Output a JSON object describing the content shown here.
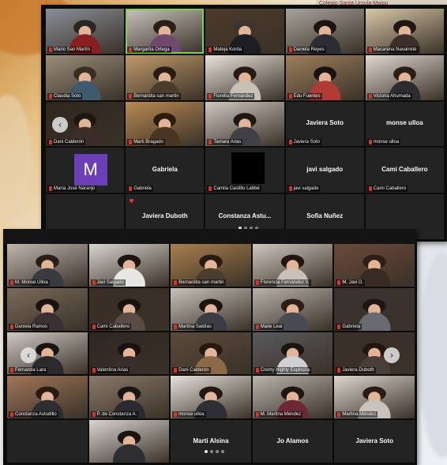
{
  "banner": "Colegio Santa Ursula-Maipu",
  "screen1": {
    "tiles": [
      {
        "name": "Mario San Martín",
        "kind": "video",
        "c1": "#8a8f99",
        "c2": "#2b2622",
        "c3": "#8a1f22"
      },
      {
        "name": "Margarita Ortega",
        "kind": "video",
        "active": true,
        "c1": "#c7c4bd",
        "c2": "#2a1e18",
        "c3": "#6f4a6e"
      },
      {
        "name": "Mateja Korda",
        "kind": "video",
        "c1": "#4d3a2b",
        "c2": "#3d3431",
        "c3": "#1d1d22"
      },
      {
        "name": "Daniela Reyes",
        "kind": "video",
        "c1": "#a8a39b",
        "c2": "#1a1512",
        "c3": "#2c2c33"
      },
      {
        "name": "Macarena Navarrete",
        "kind": "video",
        "c1": "#d7c7a7",
        "c2": "#201613",
        "c3": "#3a2f2a"
      },
      {
        "name": "Claudia Soto",
        "kind": "video",
        "c1": "#9a8e7a",
        "c2": "#3a2f27",
        "c3": "#3e5a6c"
      },
      {
        "name": "Bernardita san martin",
        "kind": "video",
        "c1": "#c09a6a",
        "c2": "#2a1c14",
        "c3": "#4a3d2e"
      },
      {
        "name": "Fiorella Fernández",
        "kind": "video",
        "c1": "#e8e2d8",
        "c2": "#2a1a14",
        "c3": "#c8c0b5"
      },
      {
        "name": "Edu Fuentes",
        "kind": "video",
        "c1": "#9c7e5c",
        "c2": "#1a1210",
        "c3": "#b03a34"
      },
      {
        "name": "Victoria Ahumada",
        "kind": "video",
        "c1": "#e0d8cf",
        "c2": "#2a1e16",
        "c3": "#2b2b30"
      },
      {
        "name": "Dani Calderón",
        "kind": "video",
        "c1": "#30261e",
        "c2": "#1e1611",
        "c3": "#3d2d2a"
      },
      {
        "name": "Marti Bragado",
        "kind": "video",
        "c1": "#b98a52",
        "c2": "#2a1c12",
        "c3": "#4a3522"
      },
      {
        "name": "Tamara Arias",
        "kind": "video",
        "c1": "#cfc8c0",
        "c2": "#1e1814",
        "c3": "#404045"
      },
      {
        "name": "Javiera Soto",
        "kind": "name",
        "center": "Javiera Soto"
      },
      {
        "name": "monse ulloa",
        "kind": "name",
        "center": "monse ulloa"
      },
      {
        "name": "María José Naranjo",
        "kind": "avatar",
        "letter": "M"
      },
      {
        "name": "Gabriela",
        "kind": "name",
        "center": "Gabriela"
      },
      {
        "name": "Camila Castillo Labbé",
        "kind": "black"
      },
      {
        "name": "javi salgado",
        "kind": "name",
        "center": "javi salgado"
      },
      {
        "name": "Cami Caballero",
        "kind": "name",
        "center": "Cami Caballero"
      },
      {
        "name": "",
        "kind": "empty"
      },
      {
        "name": "Javiera Duboth",
        "kind": "name",
        "center": "Javiera Duboth",
        "heart": true
      },
      {
        "name": "Constanza Astudillo",
        "kind": "name",
        "center": "Constanza  Astu...",
        "dots": true
      },
      {
        "name": "Sofia Nuñez",
        "kind": "name",
        "center": "Sofia Nuñez"
      },
      {
        "name": "",
        "kind": "empty"
      }
    ]
  },
  "screen2": {
    "tiles": [
      {
        "name": "M. Monse Ulloa",
        "kind": "video",
        "c1": "#bfb7ad",
        "c2": "#2a1f18",
        "c3": "#3a3a3f"
      },
      {
        "name": "Javi Salgado",
        "kind": "video",
        "c1": "#d8d4cf",
        "c2": "#1c1512",
        "c3": "#e8e6e2"
      },
      {
        "name": "Bernardita san martin",
        "kind": "video",
        "c1": "#a87f4c",
        "c2": "#2a1b12",
        "c3": "#4a3c2f"
      },
      {
        "name": "Florencia Fernández V.",
        "kind": "video",
        "c1": "#cfc6bd",
        "c2": "#24160f",
        "c3": "#c9c0b7"
      },
      {
        "name": "M. Javi D.",
        "kind": "video",
        "c1": "#6a4a3a",
        "c2": "#2e1e16",
        "c3": "#3a2a24"
      },
      {
        "name": "Daniela Ramos",
        "kind": "video",
        "c1": "#7a6a5a",
        "c2": "#1a120e",
        "c3": "#3a3034"
      },
      {
        "name": "Cami Caballero",
        "kind": "video",
        "c1": "#3a2e26",
        "c2": "#1a120e",
        "c3": "#5a4a44"
      },
      {
        "name": "Martina Saldías",
        "kind": "video",
        "c1": "#c8c2ba",
        "c2": "#1a1410",
        "c3": "#3c3c44"
      },
      {
        "name": "Maite Leal",
        "kind": "video",
        "c1": "#b8b2aa",
        "c2": "#2a1e16",
        "c3": "#4a4a52"
      },
      {
        "name": "Gabriela",
        "kind": "video",
        "c1": "#3a3232",
        "c2": "#1e1612",
        "c3": "#6a6a70"
      },
      {
        "name": "Fernanda Lara",
        "kind": "video",
        "c1": "#cfcac4",
        "c2": "#1c1410",
        "c3": "#2a2a2e"
      },
      {
        "name": "Valentina Arias",
        "kind": "video",
        "c1": "#2e2622",
        "c2": "#1a1210",
        "c3": "#3a2e2a"
      },
      {
        "name": "Dani Calderón",
        "kind": "video",
        "c1": "#5c4a3c",
        "c2": "#24180f",
        "c3": "#8b6a4a"
      },
      {
        "name": "Cremy Highly Espinoza",
        "kind": "video",
        "c1": "#5a5a5e",
        "c2": "#1a1412",
        "c3": "#d0d0d4"
      },
      {
        "name": "Javiera Duboth",
        "kind": "video",
        "c1": "#3a302a",
        "c2": "#22160e",
        "c3": "#4a3e38"
      },
      {
        "name": "Constanza Astudillo",
        "kind": "video",
        "c1": "#a0765a",
        "c2": "#2a1a12",
        "c3": "#2e2e32"
      },
      {
        "name": "P. de Constanza A.",
        "kind": "video",
        "c1": "#8a7a6a",
        "c2": "#1a1614",
        "c3": "#2a2a2e"
      },
      {
        "name": "monse ulloa",
        "kind": "video",
        "c1": "#e6e2dc",
        "c2": "#24180f",
        "c3": "#2e2e34"
      },
      {
        "name": "M. Martina Méndez",
        "kind": "video",
        "c1": "#bab4ac",
        "c2": "#1e1612",
        "c3": "#6a2a34"
      },
      {
        "name": "Martina Méndez",
        "kind": "video",
        "c1": "#dcd6ce",
        "c2": "#2a1c14",
        "c3": "#c8c2ba"
      },
      {
        "name": "",
        "kind": "empty"
      },
      {
        "name": "",
        "kind": "video",
        "c1": "#d8d4d0",
        "c2": "#1c1410",
        "c3": "#2e2e32"
      },
      {
        "name": "",
        "kind": "name",
        "center": "Marti Alsina",
        "dots": true
      },
      {
        "name": "",
        "kind": "name",
        "center": "Jo Alamos"
      },
      {
        "name": "",
        "kind": "name",
        "center": "Javiera Soto"
      }
    ]
  }
}
